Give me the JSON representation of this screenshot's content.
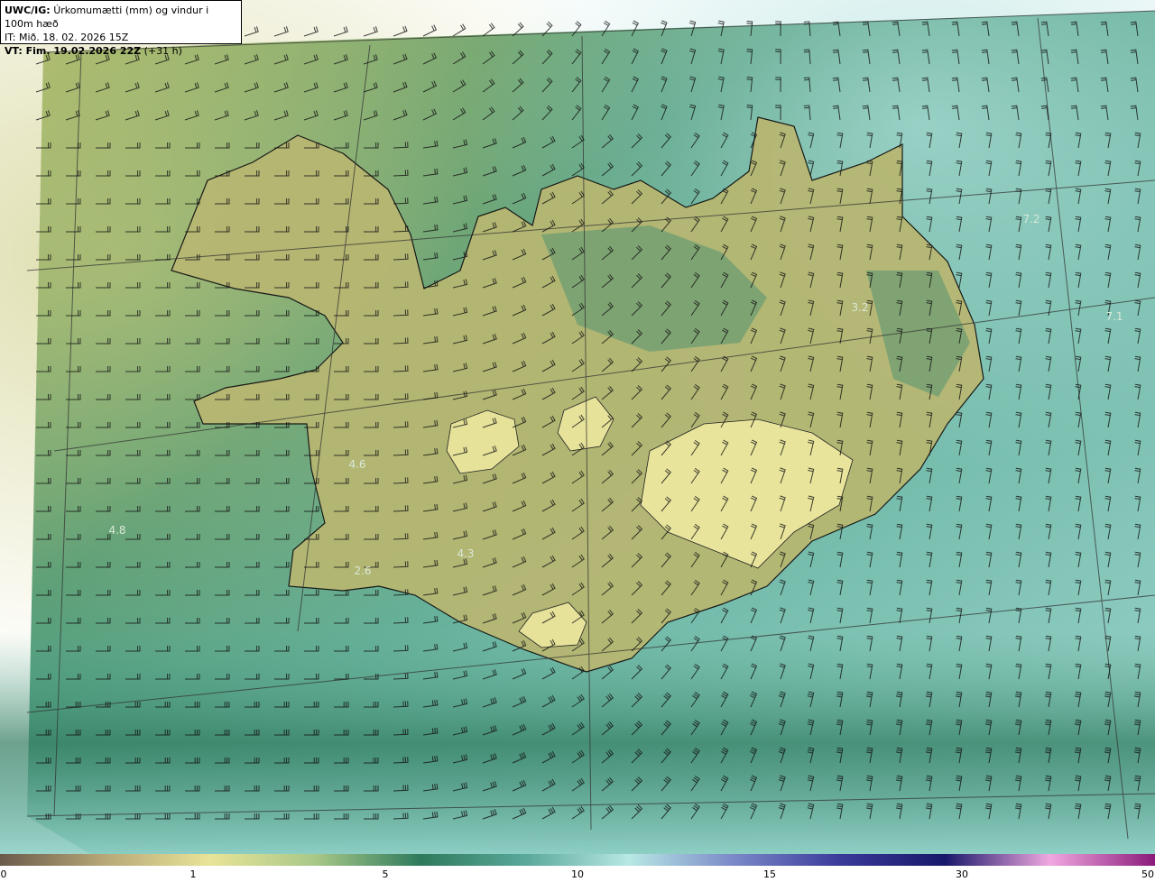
{
  "header": {
    "model_label": "UWC/IG:",
    "title": "Úrkomumætti (mm) og vindur i 100m hæð",
    "issue_time": "IT: Mið. 18. 02. 2026 15Z",
    "valid_label": "VT: Fim. 19.02.2026 22Z",
    "valid_offset": "(+31 h)"
  },
  "values": [
    "4.6",
    "4.8",
    "2.6",
    "4.3",
    "3.2",
    "7.2",
    "7.1"
  ],
  "colorbar": {
    "ticks": [
      "0",
      "1",
      "5",
      "10",
      "15",
      "30",
      "50"
    ],
    "colors": [
      "#6a5a4a",
      "#b8a878",
      "#e8e498",
      "#a8c888",
      "#2e7a5c",
      "#5aa89a",
      "#b8e8e4",
      "#7a88c8",
      "#3a3a9a",
      "#18186a",
      "#f0a8e0",
      "#8a1a7a"
    ]
  }
}
